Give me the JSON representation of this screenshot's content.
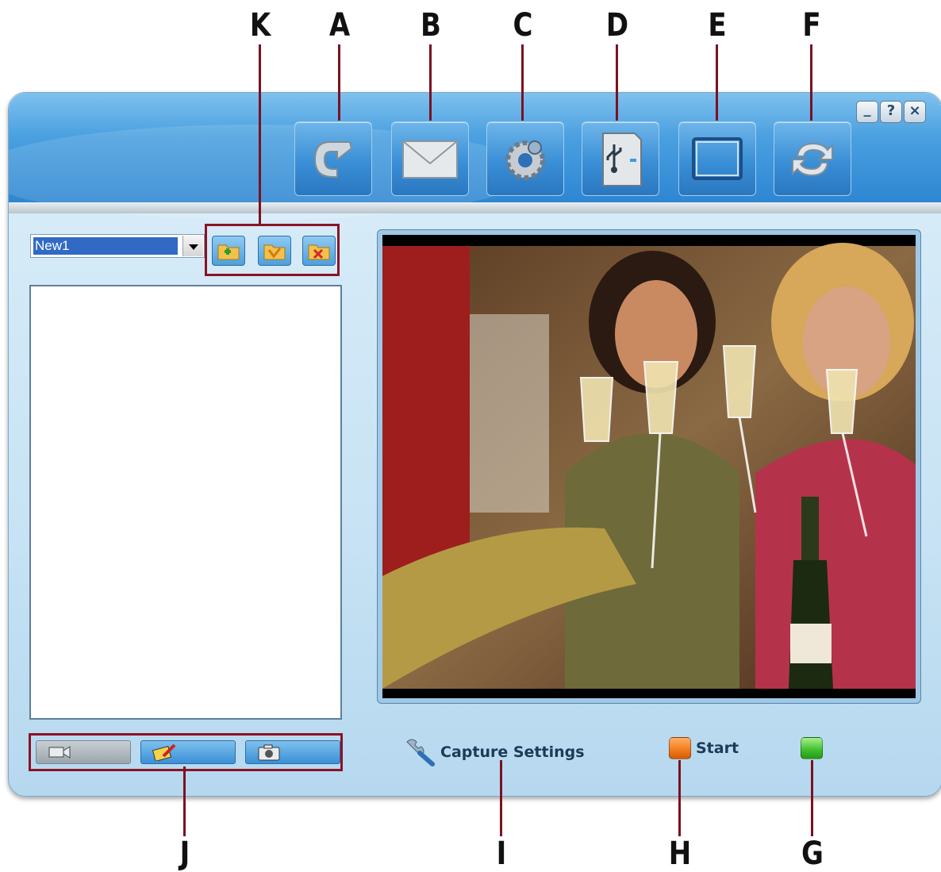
{
  "callouts": {
    "a": "A",
    "b": "B",
    "c": "C",
    "d": "D",
    "e": "E",
    "f": "F",
    "g": "G",
    "h": "H",
    "i": "I",
    "j": "J",
    "k": "K"
  },
  "window_controls": {
    "minimize": "_",
    "help": "?",
    "close": "×"
  },
  "toolbar": {
    "icons": [
      "undo-arrow-icon",
      "envelope-icon",
      "gear-settings-icon",
      "usb-device-icon",
      "window-frame-icon",
      "refresh-icon"
    ]
  },
  "album": {
    "selected": "New1",
    "buttons": [
      "add-folder-icon",
      "open-folder-icon",
      "delete-folder-icon"
    ]
  },
  "mode_tabs": [
    "video-mode-icon",
    "edit-mode-icon",
    "camera-mode-icon"
  ],
  "capture": {
    "settings_label": "Capture Settings",
    "start_label": "Start",
    "start_color": "#f27a1a",
    "record_color": "#3cbf2a"
  }
}
